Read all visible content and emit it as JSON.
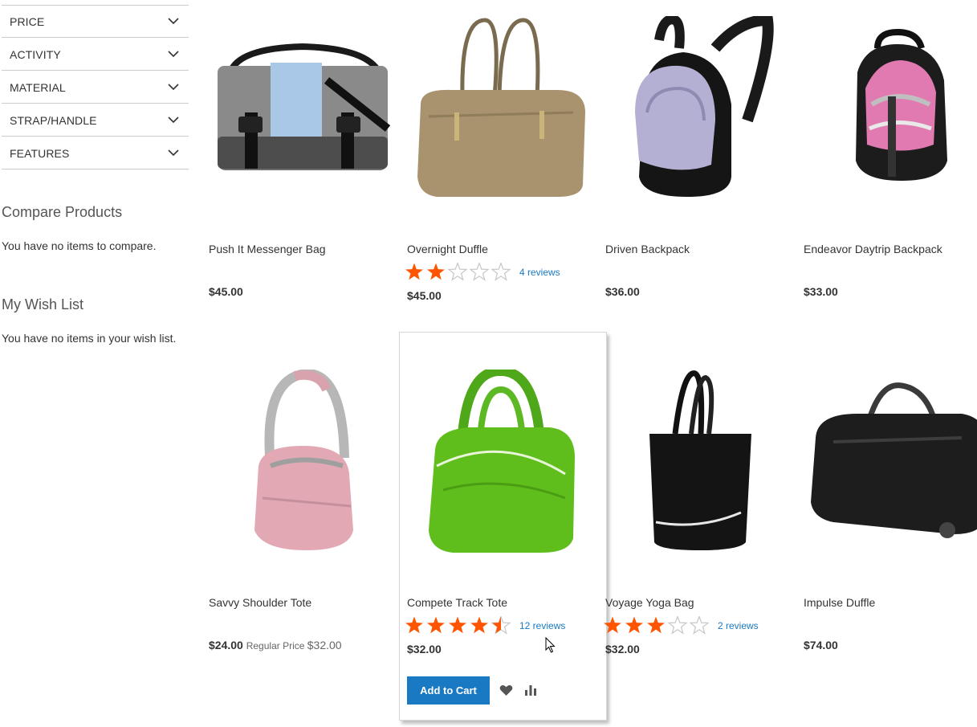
{
  "filters": [
    {
      "label": "PRICE"
    },
    {
      "label": "ACTIVITY"
    },
    {
      "label": "MATERIAL"
    },
    {
      "label": "STRAP/HANDLE"
    },
    {
      "label": "FEATURES"
    }
  ],
  "compare": {
    "title": "Compare Products",
    "text": "You have no items to compare."
  },
  "wishlist": {
    "title": "My Wish List",
    "text": "You have no items in your wish list."
  },
  "products": [
    {
      "name": "Push It Messenger Bag",
      "price": "$45.00",
      "rating": null,
      "reviews": ""
    },
    {
      "name": "Overnight Duffle",
      "price": "$45.00",
      "rating": 2,
      "reviews": "4 reviews"
    },
    {
      "name": "Driven Backpack",
      "price": "$36.00",
      "rating": null,
      "reviews": ""
    },
    {
      "name": "Endeavor Daytrip Backpack",
      "price": "$33.00",
      "rating": null,
      "reviews": ""
    },
    {
      "name": "Savvy Shoulder Tote",
      "price": "$24.00",
      "regular_label": "Regular Price",
      "regular_price": "$32.00",
      "rating": null,
      "reviews": ""
    },
    {
      "name": "Compete Track Tote",
      "price": "$32.00",
      "rating": 4.5,
      "reviews": "12 reviews"
    },
    {
      "name": "Voyage Yoga Bag",
      "price": "$32.00",
      "rating": 3,
      "reviews": "2 reviews"
    },
    {
      "name": "Impulse Duffle",
      "price": "$74.00",
      "rating": null,
      "reviews": ""
    }
  ],
  "actions": {
    "add_to_cart": "Add to Cart"
  },
  "colors": {
    "accent": "#1979c3",
    "star": "#ff5501",
    "star_empty": "#c7c7c7"
  }
}
